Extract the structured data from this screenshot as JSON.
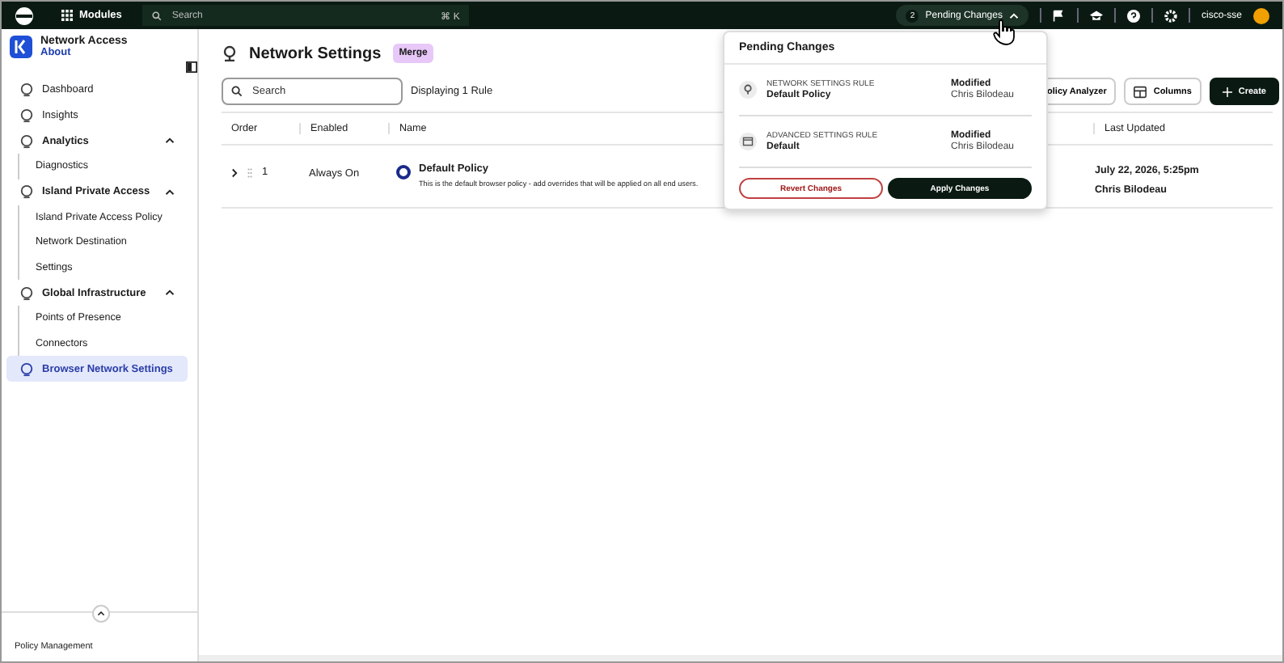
{
  "topbar": {
    "modules": "Modules",
    "search": {
      "placeholder": "Search",
      "shortcut": "⌘ K"
    },
    "pending": {
      "count": "2",
      "label": "Pending Changes",
      "expanded": true
    },
    "account": "cisco-sse"
  },
  "sidebar": {
    "app": {
      "title": "Network Access",
      "link": "About"
    },
    "items": [
      {
        "label": "Dashboard",
        "kind": "link",
        "selected": false
      },
      {
        "label": "Insights",
        "kind": "link",
        "selected": false
      },
      {
        "label": "Analytics",
        "kind": "group",
        "selected": false,
        "expanded": true,
        "children": [
          {
            "label": "Diagnostics"
          }
        ]
      },
      {
        "label": "Island Private Access",
        "kind": "group",
        "selected": false,
        "expanded": true,
        "children": [
          {
            "label": "Island Private Access Policy"
          },
          {
            "label": "Network Destination"
          },
          {
            "label": "Settings"
          }
        ]
      },
      {
        "label": "Global Infrastructure",
        "kind": "group",
        "selected": false,
        "expanded": true,
        "children": [
          {
            "label": "Points of Presence"
          },
          {
            "label": "Connectors"
          }
        ]
      },
      {
        "label": "Browser Network Settings",
        "kind": "link",
        "selected": true
      }
    ],
    "footer": "Policy Management"
  },
  "page": {
    "title": "Network Settings",
    "badge": "Merge",
    "search": {
      "placeholder": "Search"
    },
    "count": "Displaying 1 Rule",
    "buttons": [
      {
        "label": "olicy Analyzer",
        "kind": "outline"
      },
      {
        "label": "Columns",
        "kind": "columns"
      },
      {
        "label": "Create",
        "kind": "primary"
      }
    ]
  },
  "table": {
    "columns": [
      "Order",
      "Enabled",
      "Name",
      "Last Updated"
    ],
    "rows": [
      {
        "order": "1",
        "enabled": "Always On",
        "name": "Default Policy",
        "description": "This is the default browser policy - add overrides that will be applied on all end users.",
        "updated": "July 22, 2026, 5:25pm",
        "updated_by": "Chris Bilodeau"
      }
    ]
  },
  "popover": {
    "title": "Pending Changes",
    "changes": [
      {
        "kind": "network",
        "type": "NETWORK SETTINGS RULE",
        "name": "Default Policy",
        "status": "Modified",
        "user": "Chris Bilodeau"
      },
      {
        "kind": "advanced",
        "type": "ADVANCED SETTINGS RULE",
        "name": "Default",
        "status": "Modified",
        "user": "Chris Bilodeau"
      }
    ],
    "revert": "Revert Changes",
    "apply": "Apply Changes"
  }
}
